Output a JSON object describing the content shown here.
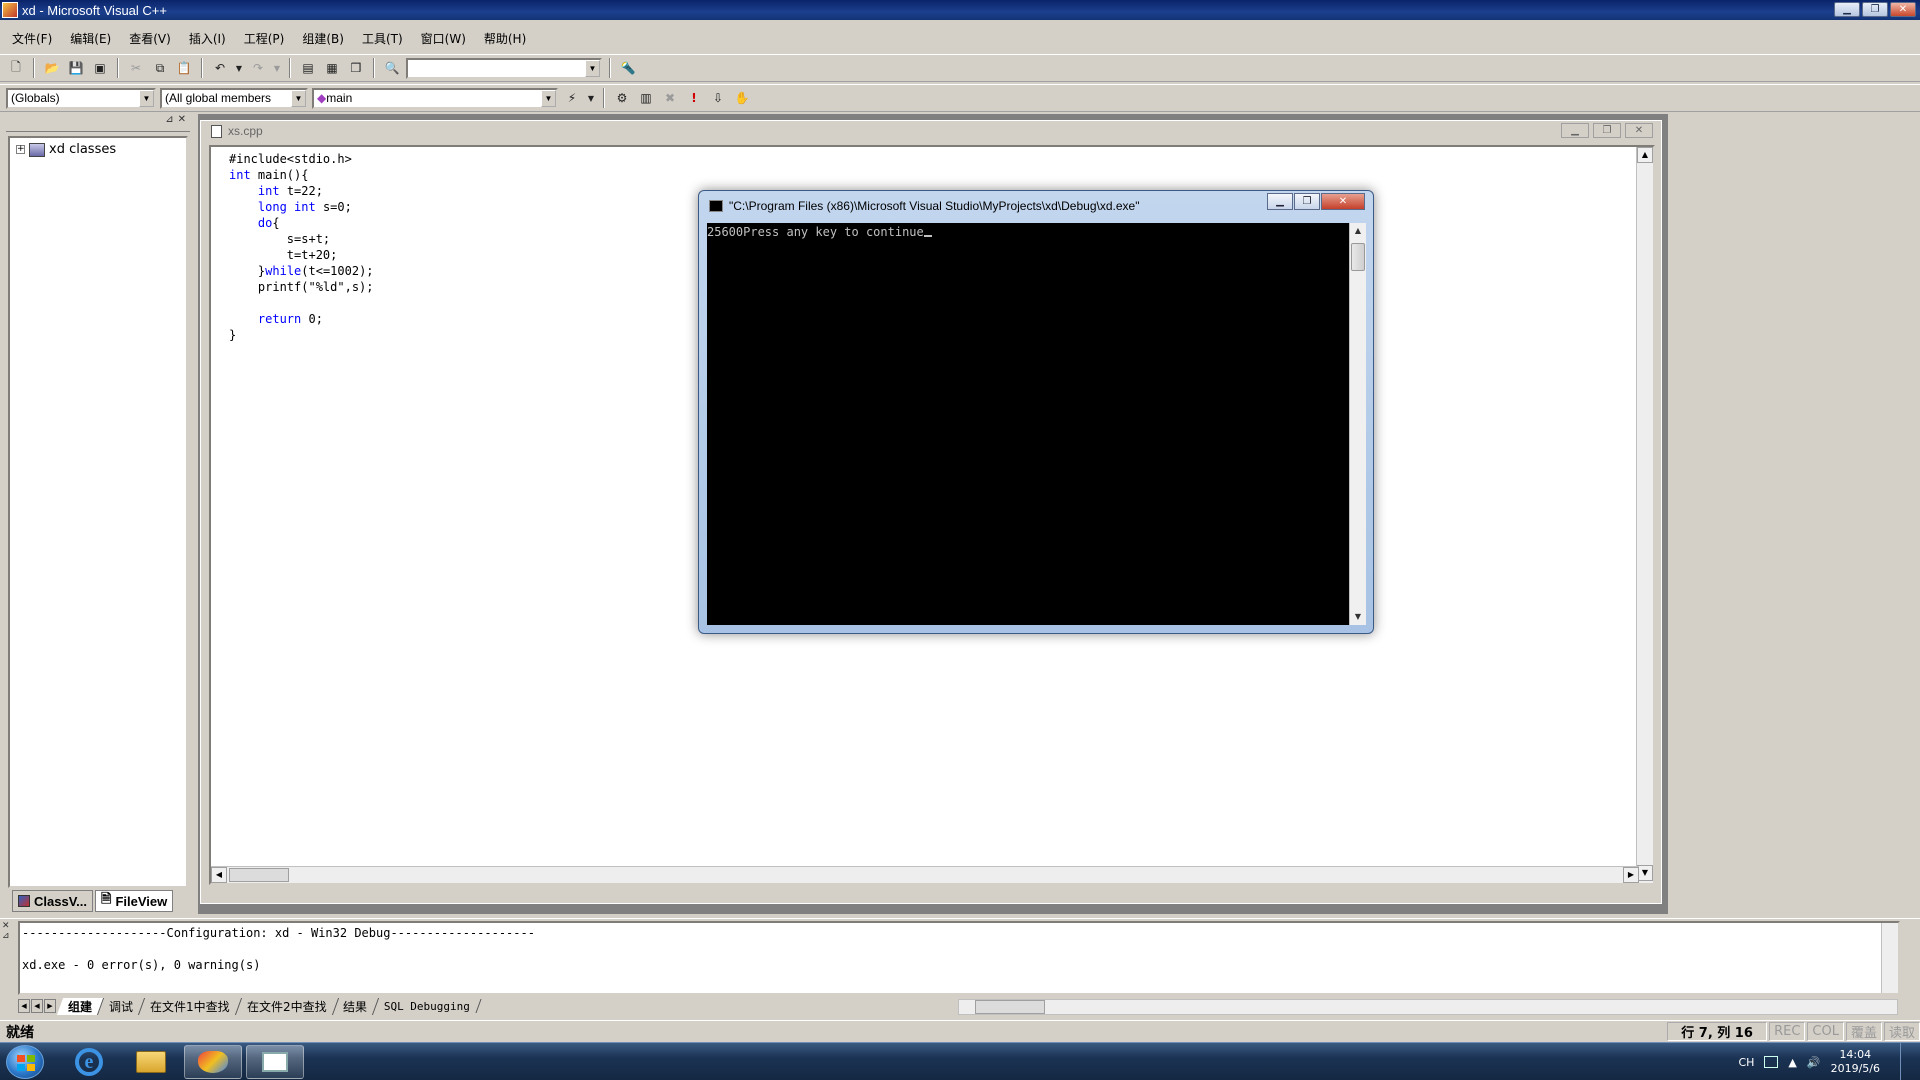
{
  "window": {
    "title": "xd - Microsoft Visual C++",
    "min_glyph": "▁",
    "max_glyph": "❐",
    "close_glyph": "✕"
  },
  "menu": [
    {
      "label": "文件(F)"
    },
    {
      "label": "编辑(E)"
    },
    {
      "label": "查看(V)"
    },
    {
      "label": "插入(I)"
    },
    {
      "label": "工程(P)"
    },
    {
      "label": "组建(B)"
    },
    {
      "label": "工具(T)"
    },
    {
      "label": "窗口(W)"
    },
    {
      "label": "帮助(H)"
    }
  ],
  "toolbar2": {
    "scope_combo": "(Globals)",
    "members_combo": "(All global members",
    "function_combo": "main"
  },
  "workspace": {
    "tree_root": "xd classes",
    "expander": "+",
    "tabs": [
      {
        "label": "ClassV..."
      },
      {
        "label": "FileView"
      }
    ]
  },
  "editor": {
    "file_tab": "xs.cpp",
    "code": {
      "l1": "#include<stdio.h>",
      "l2_kw": "int",
      "l2_rest": " main(){",
      "l3_kw": "int",
      "l3_rest": " t=22;",
      "l4_kw1": "long",
      "l4_kw2": "int",
      "l4_rest": " s=0;",
      "l5_kw": "do",
      "l5_rest": "{",
      "l6": "s=s+t;",
      "l7": "t=t+20;",
      "l8_pre": "}",
      "l8_kw": "while",
      "l8_rest": "(t<=1002);",
      "l9": "printf(\"%ld\",s);",
      "l11_kw": "return",
      "l11_rest": " 0;",
      "l12": "}"
    }
  },
  "console": {
    "title": "\"C:\\Program Files (x86)\\Microsoft Visual Studio\\MyProjects\\xd\\Debug\\xd.exe\"",
    "output": "25600Press any key to continue"
  },
  "output_pane": {
    "line1": "--------------------Configuration: xd - Win32 Debug--------------------",
    "line2": "xd.exe - 0 error(s), 0 warning(s)",
    "tabs": [
      {
        "label": "组建"
      },
      {
        "label": "调试"
      },
      {
        "label": "在文件1中查找"
      },
      {
        "label": "在文件2中查找"
      },
      {
        "label": "结果"
      },
      {
        "label": "SQL Debugging"
      }
    ]
  },
  "statusbar": {
    "status": "就绪",
    "position": "行 7, 列 16",
    "rec": "REC",
    "col": "COL",
    "ovr": "覆盖",
    "read": "读取"
  },
  "taskbar": {
    "ime": "CH",
    "time": "14:04",
    "date": "2019/5/6"
  },
  "colors": {
    "keyword": "#0000ff",
    "titlebar": "#0a246a",
    "console_bg": "#000000"
  }
}
